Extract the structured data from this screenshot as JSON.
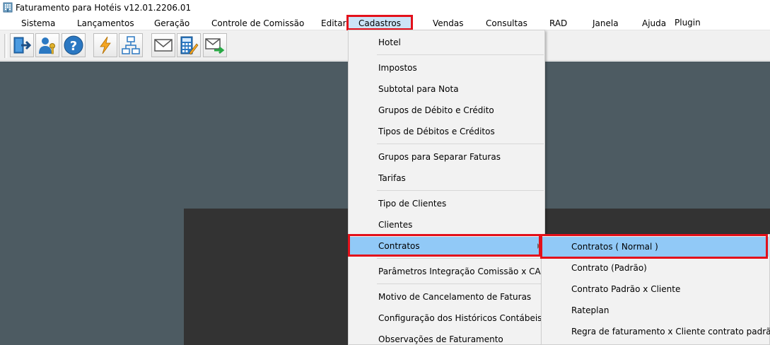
{
  "window": {
    "title": "Faturamento para Hotéis v12.01.2206.01",
    "icon": "building-icon"
  },
  "menubar": {
    "items": [
      {
        "label": "Sistema"
      },
      {
        "label": "Lançamentos"
      },
      {
        "label": "Geração"
      },
      {
        "label": "Controle de Comissão"
      },
      {
        "label": "Editar"
      },
      {
        "label": "Cadastros",
        "active": true
      },
      {
        "label": "Vendas"
      },
      {
        "label": "Consultas"
      },
      {
        "label": "RAD"
      },
      {
        "label": "Janela"
      },
      {
        "label": "Ajuda"
      },
      {
        "label": "Plugin"
      }
    ]
  },
  "toolbar": {
    "buttons": [
      {
        "icon": "exit-door-icon"
      },
      {
        "icon": "user-key-icon"
      },
      {
        "icon": "help-icon"
      },
      {
        "icon": "lightning-icon"
      },
      {
        "icon": "org-chart-icon"
      },
      {
        "icon": "envelope-icon"
      },
      {
        "icon": "calculator-edit-icon"
      },
      {
        "icon": "mail-send-icon"
      }
    ]
  },
  "cadastros_menu": {
    "items": [
      {
        "label": "Hotel"
      },
      {
        "label": "Impostos"
      },
      {
        "label": "Subtotal para Nota"
      },
      {
        "label": "Grupos de Débito e Crédito"
      },
      {
        "label": "Tipos de Débitos e Créditos"
      },
      {
        "label": "Grupos para Separar Faturas"
      },
      {
        "label": "Tarifas"
      },
      {
        "label": "Tipo de Clientes"
      },
      {
        "label": "Clientes"
      },
      {
        "label": "Contratos",
        "submenu": true,
        "highlighted": true
      },
      {
        "label": "Parâmetros Integração Comissão x CAP"
      },
      {
        "label": "Motivo de Cancelamento de Faturas"
      },
      {
        "label": "Configuração dos Históricos Contábeis"
      },
      {
        "label": "Observações de Faturamento"
      }
    ]
  },
  "contratos_submenu": {
    "items": [
      {
        "label": "Contratos ( Normal )",
        "highlighted": true
      },
      {
        "label": "Contrato (Padrão)"
      },
      {
        "label": "Contrato Padrão x Cliente"
      },
      {
        "label": "Rateplan"
      },
      {
        "label": "Regra de faturamento x Cliente contrato padrão"
      }
    ]
  },
  "colors": {
    "highlight_border": "#e3111b",
    "menu_hover": "#91c9f7",
    "menubar_active": "#cce4f7",
    "workspace": "#4d5b62",
    "inner_panel": "#333333"
  }
}
